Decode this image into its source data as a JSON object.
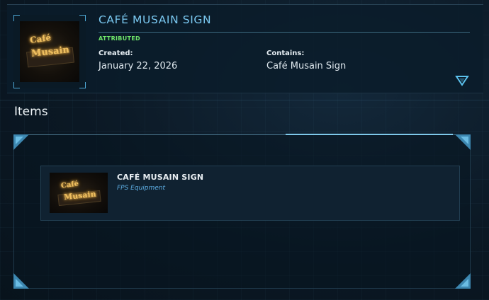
{
  "header": {
    "title": "CAFÉ MUSAIN SIGN",
    "badge": "ATTRIBUTED",
    "created_label": "Created:",
    "created_value": "January 22, 2026",
    "contains_label": "Contains:",
    "contains_value": "Café Musain Sign",
    "thumb_sign_line1": "Café",
    "thumb_sign_line2": "Musain",
    "expand_icon": "chevron-down-triangle-icon"
  },
  "items_section": {
    "title": "Items",
    "items": [
      {
        "name": "CAFÉ MUSAIN SIGN",
        "type": "FPS Equipment",
        "sign_line1": "Café",
        "sign_line2": "Musain"
      }
    ]
  },
  "colors": {
    "accent": "#7ac8f0",
    "badge": "#6fe56a",
    "item_type": "#5fb0e6",
    "background": "#0a1722"
  }
}
